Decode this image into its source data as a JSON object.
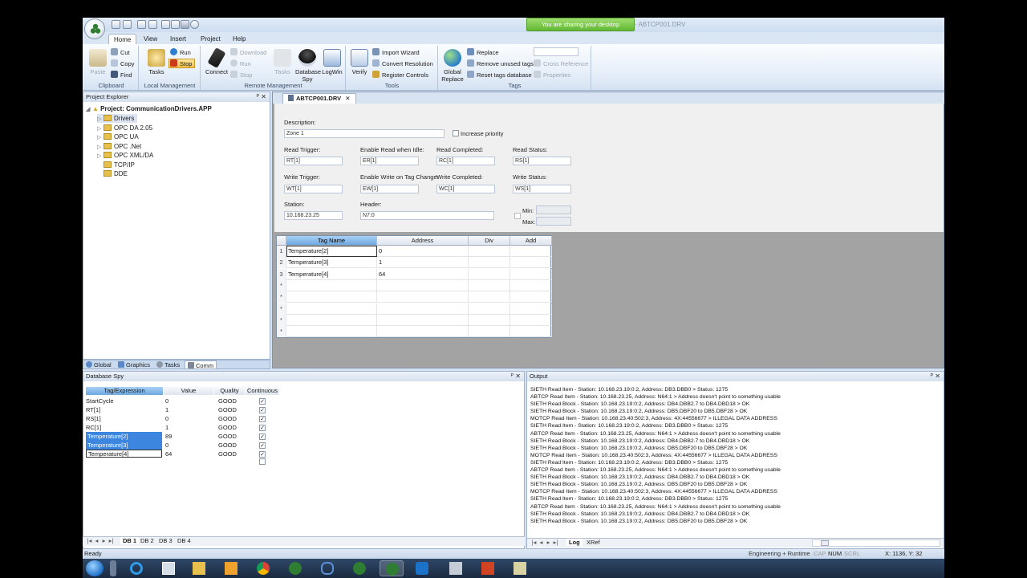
{
  "window": {
    "title": "- ABTCP001.DRV",
    "share_banner": "You are sharing your desktop"
  },
  "ribbon_tabs": [
    "Home",
    "View",
    "Insert",
    "Project",
    "Help"
  ],
  "ribbon": {
    "clipboard": {
      "paste": "Paste",
      "cut": "Cut",
      "copy": "Copy",
      "find": "Find",
      "label": "Clipboard"
    },
    "local": {
      "tasks": "Tasks",
      "run": "Run",
      "stop": "Stop",
      "label": "Local Management"
    },
    "remote": {
      "connect": "Connect",
      "download": "Download",
      "run": "Run",
      "stop": "Stop",
      "tasks": "Tasks",
      "database_spy_1": "Database",
      "database_spy_2": "Spy",
      "logwin": "LogWin",
      "label": "Remote Management"
    },
    "tools": {
      "verify": "Verify",
      "import_wizard": "Import Wizard",
      "convert_resolution": "Convert Resolution",
      "register_controls": "Register Controls",
      "label": "Tools"
    },
    "tags": {
      "global_replace_1": "Global",
      "global_replace_2": "Replace",
      "replace": "Replace",
      "remove_unused": "Remove unused tags",
      "reset_db": "Reset tags database",
      "cross_reference": "Cross Reference",
      "properties": "Properties",
      "label": "Tags"
    }
  },
  "explorer": {
    "title": "Project Explorer",
    "project": "Project: CommunicationDrivers.APP",
    "items": [
      "Drivers",
      "OPC DA 2.05",
      "OPC UA",
      "OPC .Net",
      "OPC XML/DA",
      "TCP/IP",
      "DDE"
    ],
    "tabs": [
      "Global",
      "Graphics",
      "Tasks",
      "Comm"
    ]
  },
  "document": {
    "tab": "ABTCP001.DRV",
    "description_label": "Description:",
    "description": "Zone 1",
    "increase_priority": "Increase priority",
    "read_trigger_label": "Read Trigger:",
    "read_trigger": "RT[1]",
    "enable_read_label": "Enable Read when Idle:",
    "enable_read": "ER[1]",
    "read_completed_label": "Read Completed:",
    "read_completed": "RC[1]",
    "read_status_label": "Read Status:",
    "read_status": "RS[1]",
    "write_trigger_label": "Write Trigger:",
    "write_trigger": "WT[1]",
    "enable_write_label": "Enable Write on Tag Change:",
    "enable_write": "EW[1]",
    "write_completed_label": "Write Completed:",
    "write_completed": "WC[1]",
    "write_status_label": "Write Status:",
    "write_status": "WS[1]",
    "station_label": "Station:",
    "station": "10.168.23.25",
    "header_label": "Header:",
    "header": "N7:0",
    "min_label": "Min:",
    "max_label": "Max:"
  },
  "grid": {
    "columns": [
      "Tag Name",
      "Address",
      "Div",
      "Add"
    ],
    "rows": [
      {
        "n": "1",
        "tag": "Temperature[2]",
        "address": "0"
      },
      {
        "n": "2",
        "tag": "Temperature[3]",
        "address": "1"
      },
      {
        "n": "3",
        "tag": "Temperature[4]",
        "address": "64"
      },
      {
        "n": "*",
        "tag": "",
        "address": ""
      },
      {
        "n": "*",
        "tag": "",
        "address": ""
      },
      {
        "n": "*",
        "tag": "",
        "address": ""
      },
      {
        "n": "*",
        "tag": "",
        "address": ""
      },
      {
        "n": "*",
        "tag": "",
        "address": ""
      }
    ]
  },
  "spy": {
    "title": "Database Spy",
    "columns": [
      "Tag/Expression",
      "Value",
      "Quality",
      "Continuous"
    ],
    "rows": [
      {
        "tag": "StartCycle",
        "value": "0",
        "quality": "GOOD"
      },
      {
        "tag": "RT[1]",
        "value": "1",
        "quality": "GOOD"
      },
      {
        "tag": "RS[1]",
        "value": "0",
        "quality": "GOOD"
      },
      {
        "tag": "RC[1]",
        "value": "1",
        "quality": "GOOD"
      },
      {
        "tag": "Temperature[2]",
        "value": "89",
        "quality": "GOOD"
      },
      {
        "tag": "Temperature[3]",
        "value": "0",
        "quality": "GOOD"
      },
      {
        "tag": "Temperature[4]",
        "value": "64",
        "quality": "GOOD"
      }
    ],
    "tabs": [
      "DB 1",
      "DB 2",
      "DB 3",
      "DB 4"
    ]
  },
  "output": {
    "title": "Output",
    "lines": [
      "SIETH Read Item - Station: 10.168.23.19:0:2, Address: DB3.DBB0 > Status: 1275",
      "ABTCP Read Item - Station: 10.168.23.25, Address: N64:1 > Address doesn't point to something usable",
      "SIETH Read Block - Station: 10.168.23.19:0:2, Address: DB4.DBB2.7 to DB4.DBD18 > OK",
      "SIETH Read Block - Station: 10.168.23.19:0:2, Address: DB5.DBF20 to DB5.DBF28 > OK",
      "MOTCP Read Item - Station: 10.168.23.40:502:3, Address: 4X:44556677 > ILLEGAL DATA ADDRESS",
      "SIETH Read Item - Station: 10.168.23.19:0:2, Address: DB3.DBB0 > Status: 1275",
      "ABTCP Read Item - Station: 10.168.23.25, Address: N64:1 > Address doesn't point to something usable",
      "SIETH Read Block - Station: 10.168.23.19:0:2, Address: DB4.DBB2.7 to DB4.DBD18 > OK",
      "SIETH Read Block - Station: 10.168.23.19:0:2, Address: DB5.DBF20 to DB5.DBF28 > OK",
      "MOTCP Read Item - Station: 10.168.23.40:502:3, Address: 4X:44556677 > ILLEGAL DATA ADDRESS",
      "SIETH Read Item - Station: 10.168.23.19:0:2, Address: DB3.DBB0 > Status: 1275",
      "ABTCP Read Item - Station: 10.168.23.25, Address: N64:1 > Address doesn't point to something usable",
      "SIETH Read Block - Station: 10.168.23.19:0:2, Address: DB4.DBB2.7 to DB4.DBD18 > OK",
      "SIETH Read Block - Station: 10.168.23.19:0:2, Address: DB5.DBF20 to DB5.DBF28 > OK",
      "MOTCP Read Item - Station: 10.168.23.40:502:3, Address: 4X:44556677 > ILLEGAL DATA ADDRESS",
      "SIETH Read Item - Station: 10.168.23.19:0:2, Address: DB3.DBB0 > Status: 1275",
      "ABTCP Read Item - Station: 10.168.23.25, Address: N64:1 > Address doesn't point to something usable",
      "SIETH Read Block - Station: 10.168.23.19:0:2, Address: DB4.DBB2.7 to DB4.DBD18 > OK",
      "SIETH Read Block - Station: 10.168.23.19:0:2, Address: DB5.DBF20 to DB5.DBF28 > OK"
    ],
    "tabs": [
      "Log",
      "XRef"
    ]
  },
  "status": {
    "ready": "Ready",
    "mode": "Engineering + Runtime",
    "cap": "CAP",
    "num": "NUM",
    "scrl": "SCRL",
    "coords": "X: 1136, Y: 32"
  },
  "colors": {
    "accent": "#3c86e0",
    "ribbon": "#dbe6f4",
    "logo_green": "#2e7d32"
  },
  "taskbar": [
    "start-orb",
    "explorer-bar",
    "internet-explorer",
    "window-manager",
    "folders",
    "outlook",
    "chrome",
    "studio-1",
    "link",
    "studio-2",
    "studio-3",
    "teamviewer",
    "tools",
    "powerpoint",
    "notes"
  ]
}
